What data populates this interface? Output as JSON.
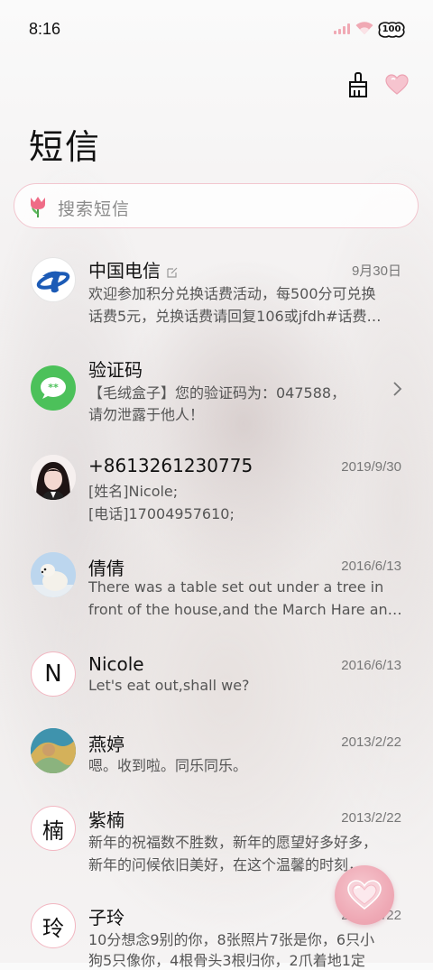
{
  "status_bar": {
    "time": "8:16",
    "battery": "100"
  },
  "toolbar": {
    "clean_icon": "broom-icon",
    "theme_icon": "heart-icon"
  },
  "header": {
    "title": "短信"
  },
  "search": {
    "placeholder": "搜索短信",
    "icon": "tulip-icon"
  },
  "messages": [
    {
      "name": "中国电信",
      "date": "9月30日",
      "lines": [
        "欢迎参加积分兑换话费活动，每500分可兑换",
        "话费5元，兑换话费请回复106或jfdh#话费…"
      ]
    },
    {
      "name": "验证码",
      "date": "",
      "lines": [
        "【毛绒盒子】您的验证码为：047588，",
        "请勿泄露于他人！"
      ]
    },
    {
      "name": "+8613261230775",
      "date": "2019/9/30",
      "lines": [
        "[姓名]Nicole;",
        "[电话]17004957610;"
      ]
    },
    {
      "name": "倩倩",
      "date": "2016/6/13",
      "lines": [
        "There was a table set out under a tree in",
        "front of the house,and the March Hare an…"
      ]
    },
    {
      "name": "Nicole",
      "date": "2016/6/13",
      "avatar_letter": "N",
      "lines": [
        "Let's eat out,shall we?"
      ]
    },
    {
      "name": "燕婷",
      "date": "2013/2/22",
      "lines": [
        "嗯。收到啦。同乐同乐。"
      ]
    },
    {
      "name": "紫楠",
      "date": "2013/2/22",
      "avatar_letter": "楠",
      "lines": [
        "新年的祝福数不胜数，新年的愿望好多好多，",
        "新年的问候依旧美好，在这个温馨的时刻，…"
      ]
    },
    {
      "name": "子玲",
      "date": "2013/2/22",
      "avatar_letter": "玲",
      "lines": [
        "10分想念9别的你，8张照片7张是你，6只小",
        "狗5只像你，4根骨头3根归你，2爪着地1定"
      ]
    }
  ],
  "fab": {
    "icon": "heart-icon"
  },
  "colors": {
    "accent_pink": "#f2b6c1",
    "fab_pink": "#efaab6",
    "green": "#4cc15a",
    "telecom_blue": "#1c5bb6"
  }
}
